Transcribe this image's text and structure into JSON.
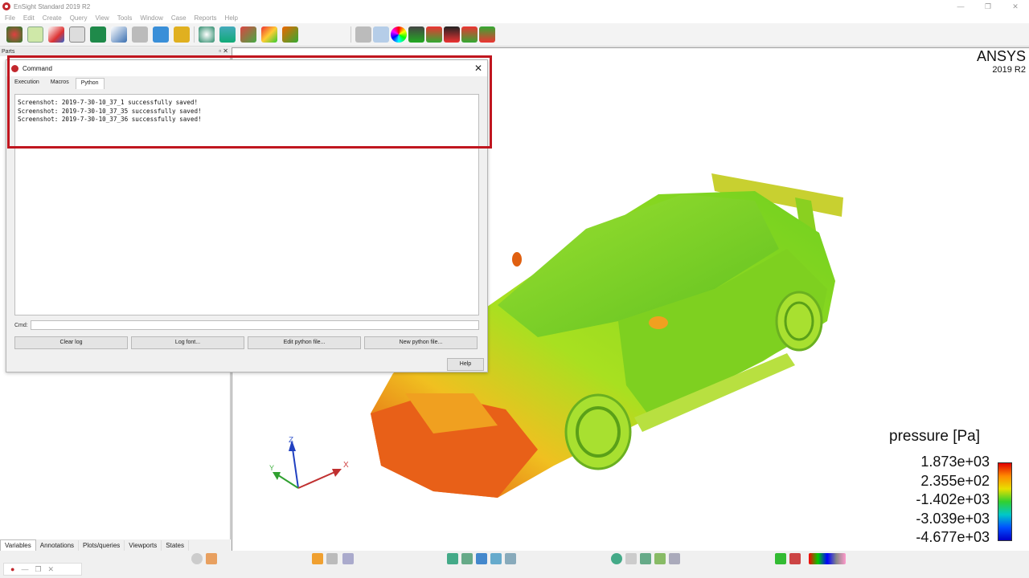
{
  "window": {
    "title": "EnSight Standard 2019 R2",
    "controls": [
      "—",
      "❐",
      "✕"
    ]
  },
  "menu": [
    "File",
    "Edit",
    "Create",
    "Query",
    "View",
    "Tools",
    "Window",
    "Case",
    "Reports",
    "Help"
  ],
  "left_panel": {
    "header": "Parts",
    "bottom_tabs": [
      "Variables",
      "Annotations",
      "Plots/queries",
      "Viewports",
      "States"
    ],
    "active_tab": "Variables"
  },
  "viewport": {
    "brand": "ANSYS",
    "version": "2019 R2",
    "legend": {
      "title": "pressure [Pa]",
      "values": [
        "1.873e+03",
        "2.355e+02",
        "-1.402e+03",
        "-3.039e+03",
        "-4.677e+03"
      ]
    },
    "triad": {
      "x": "X",
      "y": "Y",
      "z": "Z"
    }
  },
  "command_dialog": {
    "title": "Command",
    "tabs": [
      "Execution",
      "Macros",
      "Python"
    ],
    "active_tab": "Python",
    "log_lines": [
      "Screenshot: 2019-7-30-10_37_1 successfully saved!",
      "Screenshot: 2019-7-30-10_37_35 successfully saved!",
      "Screenshot: 2019-7-30-10_37_36 successfully saved!"
    ],
    "cmd_label": "Cmd:",
    "cmd_value": "",
    "buttons": [
      "Clear log",
      "Log font...",
      "Edit python file...",
      "New python file..."
    ],
    "help": "Help"
  },
  "colors": {
    "highlight": "#c0161f",
    "accent": "#c2272d"
  }
}
